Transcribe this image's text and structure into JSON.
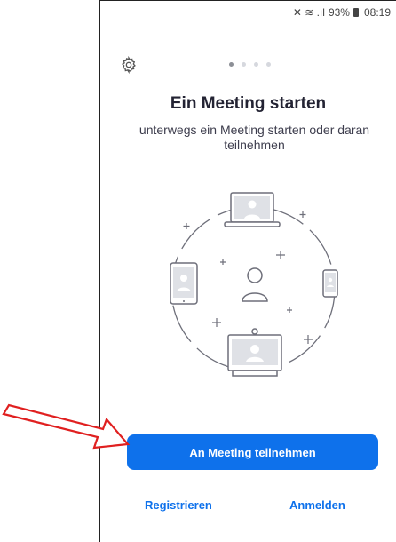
{
  "statusbar": {
    "signal_text": "≀¡ ≈ .∥",
    "battery_percent": "93%",
    "time": "08:19"
  },
  "onboarding": {
    "page_index": 0,
    "page_count": 4,
    "title": "Ein Meeting starten",
    "subtitle": "unterwegs ein Meeting starten oder daran teilnehmen"
  },
  "actions": {
    "join_label": "An Meeting teilnehmen",
    "register_label": "Registrieren",
    "login_label": "Anmelden"
  },
  "icons": {
    "settings": "gear-icon",
    "annotation": "red-arrow-icon"
  },
  "colors": {
    "accent": "#0e71eb",
    "arrow": "#e02020"
  }
}
